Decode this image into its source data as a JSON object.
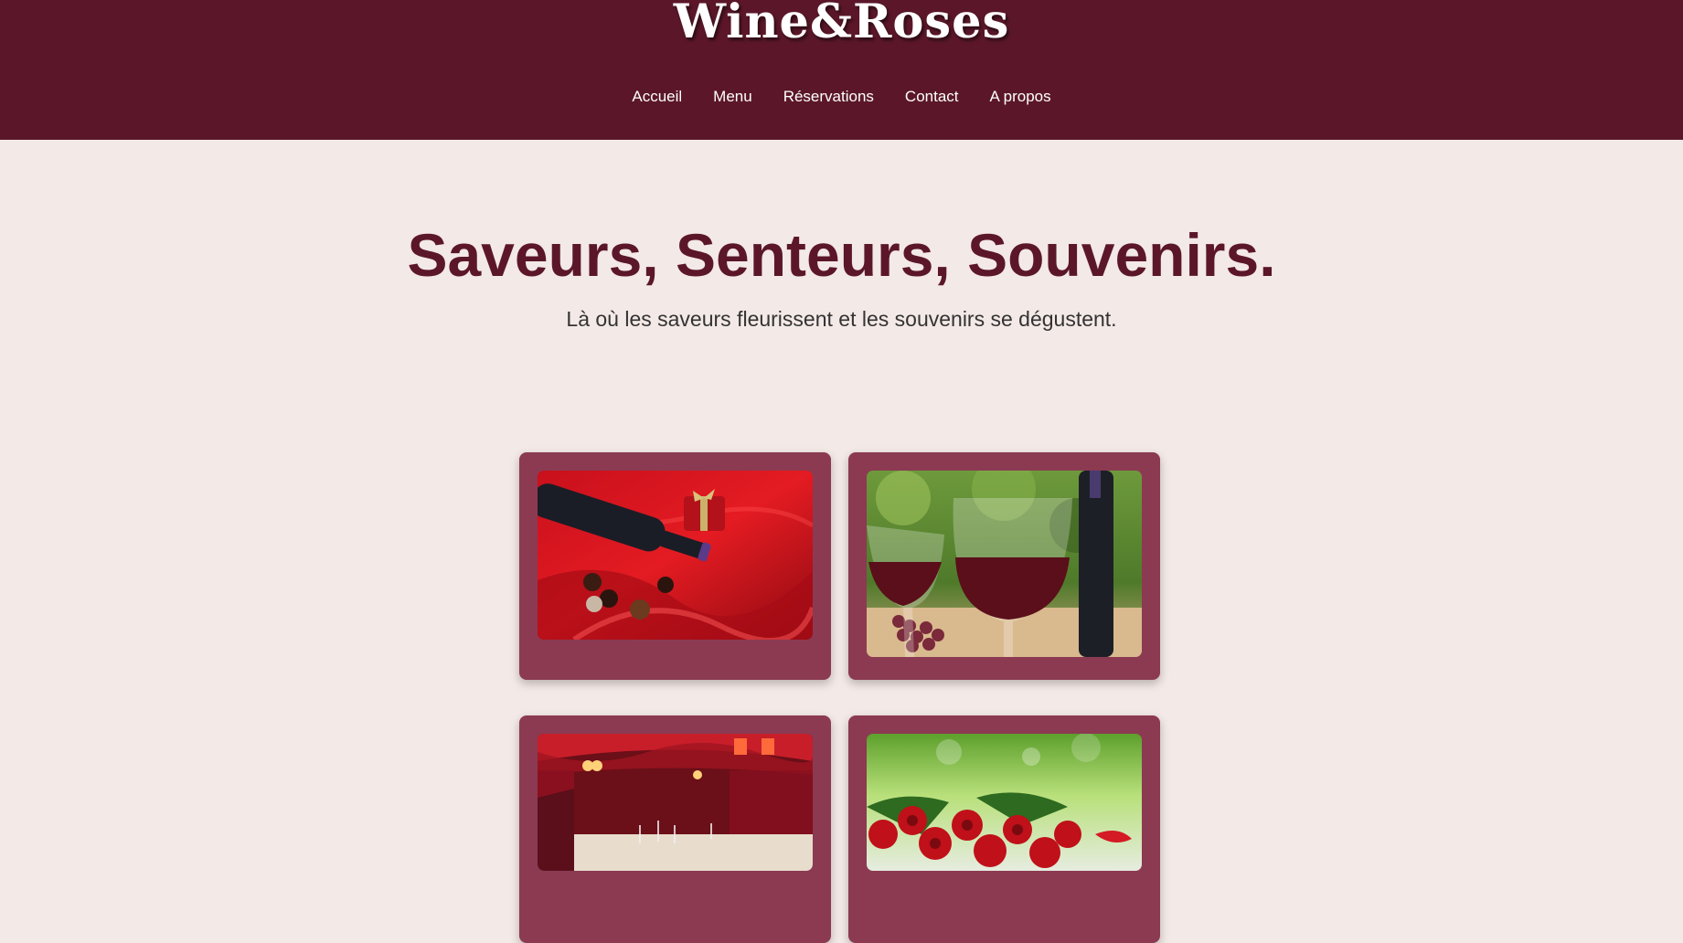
{
  "header": {
    "brand": "Wine&Roses",
    "nav": [
      "Accueil",
      "Menu",
      "Réservations",
      "Contact",
      "A propos"
    ]
  },
  "hero": {
    "title": "Saveurs, Senteurs, Souvenirs.",
    "subtitle": "Là où les saveurs fleurissent et les souvenirs se dégustent."
  },
  "gallery": {
    "images": [
      "wine-chocolate-red-satin",
      "red-wine-glasses",
      "restaurant-dining-room",
      "red-roses"
    ]
  },
  "colors": {
    "header_bg": "#5b1729",
    "page_bg": "#f3e9e6",
    "title": "#5b1729",
    "card_bg": "#8b3a52"
  }
}
